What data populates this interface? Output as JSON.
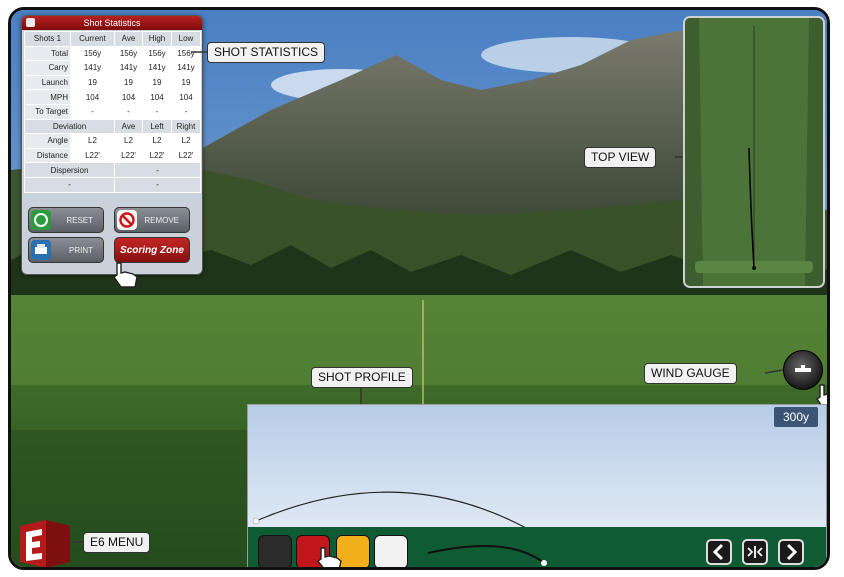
{
  "stats_panel": {
    "title": "Shot Statistics",
    "headers": [
      "Shots 1",
      "Current",
      "Ave",
      "High",
      "Low"
    ],
    "rows": [
      {
        "label": "Total",
        "current": "156y",
        "ave": "156y",
        "high": "156y",
        "low": "156y"
      },
      {
        "label": "Carry",
        "current": "141y",
        "ave": "141y",
        "high": "141y",
        "low": "141y"
      },
      {
        "label": "Launch",
        "current": "19",
        "ave": "19",
        "high": "19",
        "low": "19"
      },
      {
        "label": "MPH",
        "current": "104",
        "ave": "104",
        "high": "104",
        "low": "104"
      },
      {
        "label": "To Target",
        "current": "-",
        "ave": "-",
        "high": "-",
        "low": "-"
      }
    ],
    "deviation_header": {
      "label": "Deviation",
      "ave": "Ave",
      "left": "Left",
      "right": "Right"
    },
    "deviation_rows": [
      {
        "label": "Angle",
        "current": "L2",
        "ave": "L2",
        "left": "L2",
        "right": "L2"
      },
      {
        "label": "Distance",
        "current": "L22'",
        "ave": "L22'",
        "left": "L22'",
        "right": "L22'"
      }
    ],
    "dispersion": {
      "label": "Dispersion",
      "value": "-",
      "left_value": "-",
      "right_value": "-"
    },
    "buttons": {
      "reset": "RESET",
      "remove": "REMOVE",
      "print": "PRINT",
      "scoring_zone": "Scoring Zone"
    }
  },
  "callouts": {
    "shot_statistics": "SHOT STATISTICS",
    "top_view": "TOP VIEW",
    "wind_gauge": "WIND GAUGE",
    "shot_profile": "SHOT PROFILE",
    "e6_menu": "E6 MENU"
  },
  "shot_profile": {
    "distance_label": "300y",
    "swatch_colors": [
      "#2b2b2b",
      "#c0161c",
      "#f2b01c",
      "#f2f2f2"
    ]
  },
  "logo": {
    "text": "E6"
  },
  "colors": {
    "accent_red": "#b62020",
    "profile_bar_green": "#0f5b34",
    "distance_badge": "#3d5575"
  }
}
